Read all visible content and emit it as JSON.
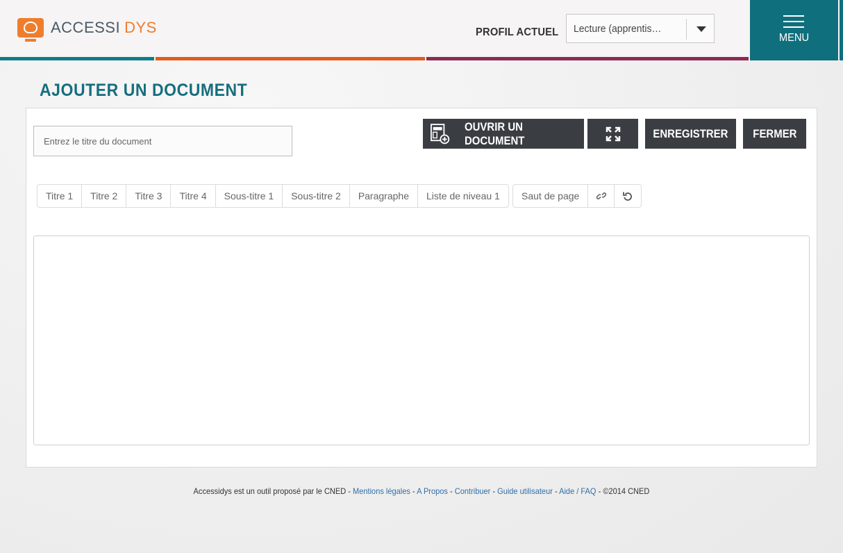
{
  "header": {
    "logo": {
      "brand_left": "ACCESSI",
      "brand_right": "DYS"
    },
    "profile_label": "PROFIL ACTUEL",
    "profile_value": "Lecture (apprentis…",
    "menu_label": "MENU",
    "stripe_colors": [
      "#0f7d88",
      "#e35a1d",
      "#8d2a52"
    ]
  },
  "page": {
    "title": "AJOUTER UN DOCUMENT"
  },
  "form": {
    "title_placeholder": "Entrez le titre du document",
    "open_label": "OUVRIR UN DOCUMENT",
    "save_label": "ENREGISTRER",
    "close_label": "FERMER"
  },
  "toolbar": {
    "styles": [
      "Titre 1",
      "Titre 2",
      "Titre 3",
      "Titre 4",
      "Sous-titre 1",
      "Sous-titre 2",
      "Paragraphe",
      "Liste de niveau 1"
    ],
    "page_break": "Saut de page",
    "icons": [
      "link-icon",
      "undo-icon"
    ]
  },
  "footer": {
    "intro": "Accessidys est un outil proposé par le CNED - ",
    "links": [
      "Mentions légales",
      "A Propos",
      "Contribuer",
      "Guide utilisateur",
      "Aide / FAQ"
    ],
    "separator": " - ",
    "copyright": " - ©2014 CNED"
  },
  "colors": {
    "accent": "#0f6f7d",
    "title": "#156e7e",
    "logo": "#ef7d2e",
    "dark_button": "#3a3d42",
    "link": "#2f6fa8"
  }
}
